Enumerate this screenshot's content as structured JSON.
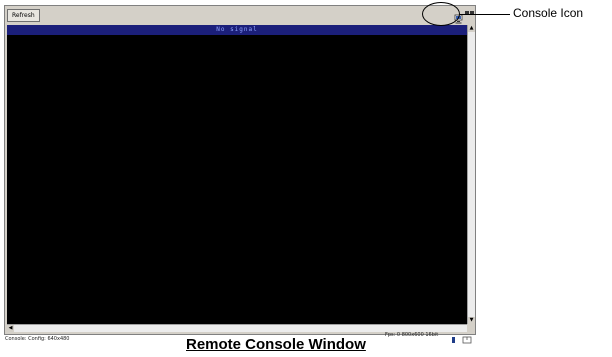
{
  "window": {
    "toolbar_button_label": "Refresh",
    "status_bar_text": "No signal",
    "status_bottom_left": "Console: Config: 640x480",
    "status_bottom_right": "Fps: 0  800x600  16bit",
    "console_icon": "console-icon"
  },
  "annotation": {
    "label": "Console Icon"
  },
  "caption": "Remote Console Window",
  "colors": {
    "screen": "#000000",
    "status_bar_bg": "#1b1f7a",
    "status_bar_text": "#8fa2ff",
    "window_chrome": "#d4d0c8"
  }
}
